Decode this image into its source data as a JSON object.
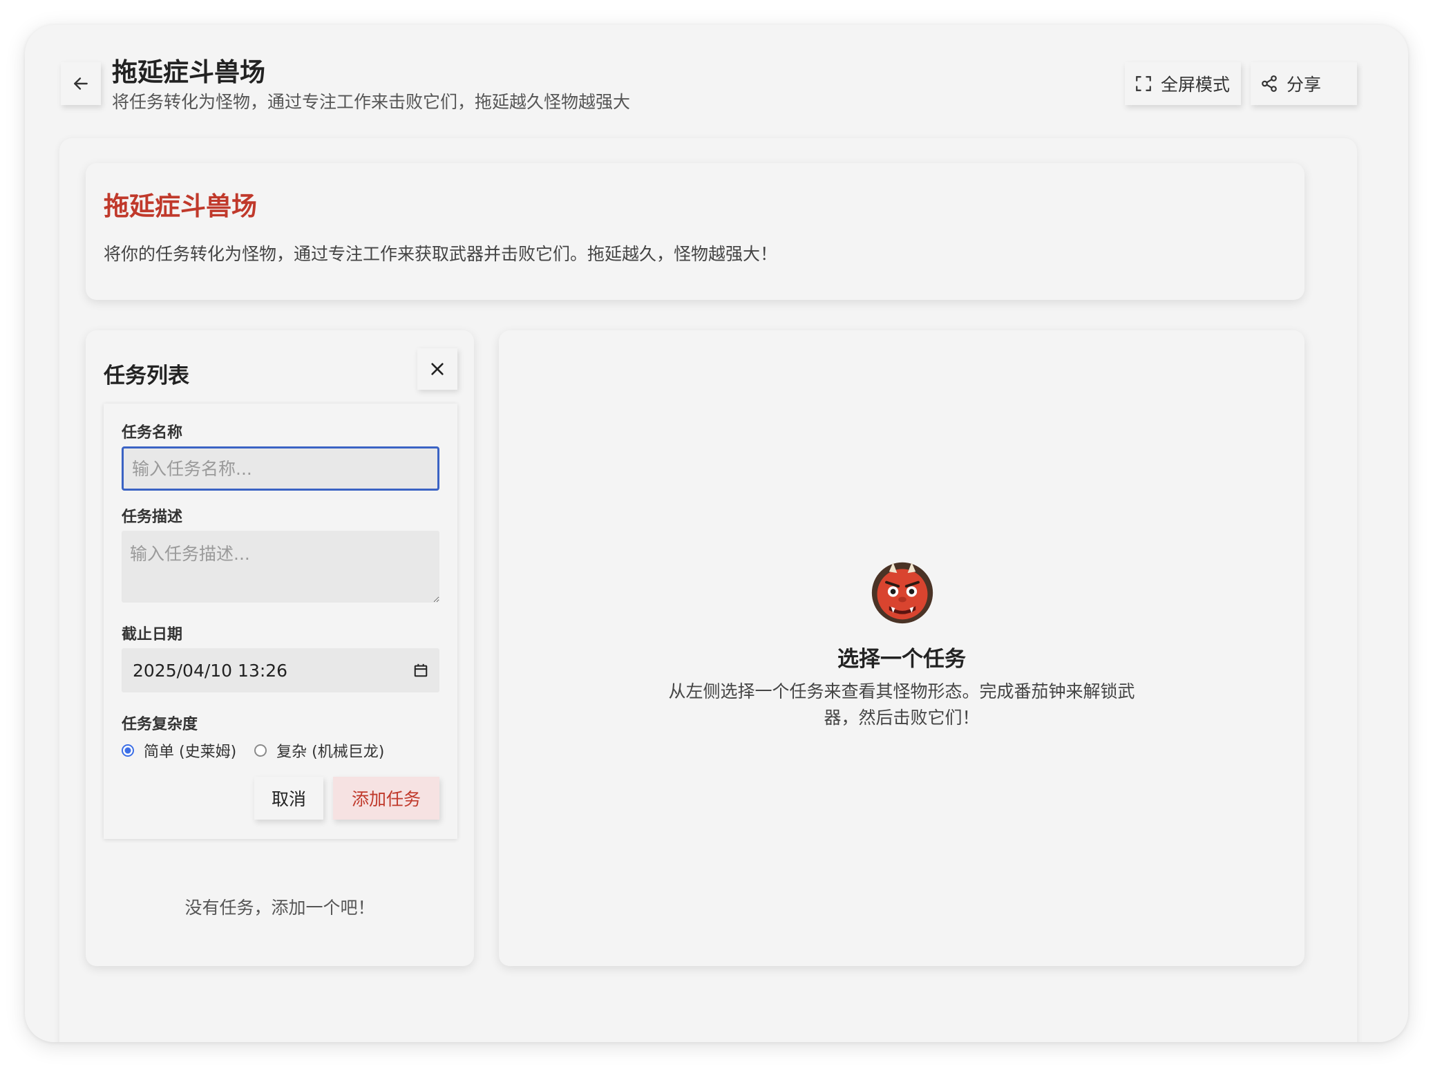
{
  "header": {
    "title": "拖延症斗兽场",
    "subtitle": "将任务转化为怪物，通过专注工作来击败它们，拖延越久怪物越强大",
    "fullscreen_label": "全屏模式",
    "share_label": "分享"
  },
  "intro": {
    "title": "拖延症斗兽场",
    "description": "将你的任务转化为怪物，通过专注工作来获取武器并击败它们。拖延越久，怪物越强大！"
  },
  "task_panel": {
    "title": "任务列表",
    "form": {
      "name_label": "任务名称",
      "name_placeholder": "输入任务名称...",
      "name_value": "",
      "desc_label": "任务描述",
      "desc_placeholder": "输入任务描述...",
      "deadline_label": "截止日期",
      "deadline_value": "2025/04/10 13:26",
      "complexity_label": "任务复杂度",
      "complexity_options": [
        {
          "label": "简单 (史莱姆)",
          "selected": true
        },
        {
          "label": "复杂 (机械巨龙)",
          "selected": false
        }
      ],
      "cancel_label": "取消",
      "submit_label": "添加任务"
    },
    "empty_text": "没有任务，添加一个吧！"
  },
  "detail_panel": {
    "icon": "ogre-monster-icon",
    "title": "选择一个任务",
    "description": "从左侧选择一个任务来查看其怪物形态。完成番茄钟来解锁武器，然后击败它们！"
  },
  "colors": {
    "accent_red": "#c0392b",
    "focus_blue": "#3b63c4",
    "background": "#f4f4f4"
  }
}
